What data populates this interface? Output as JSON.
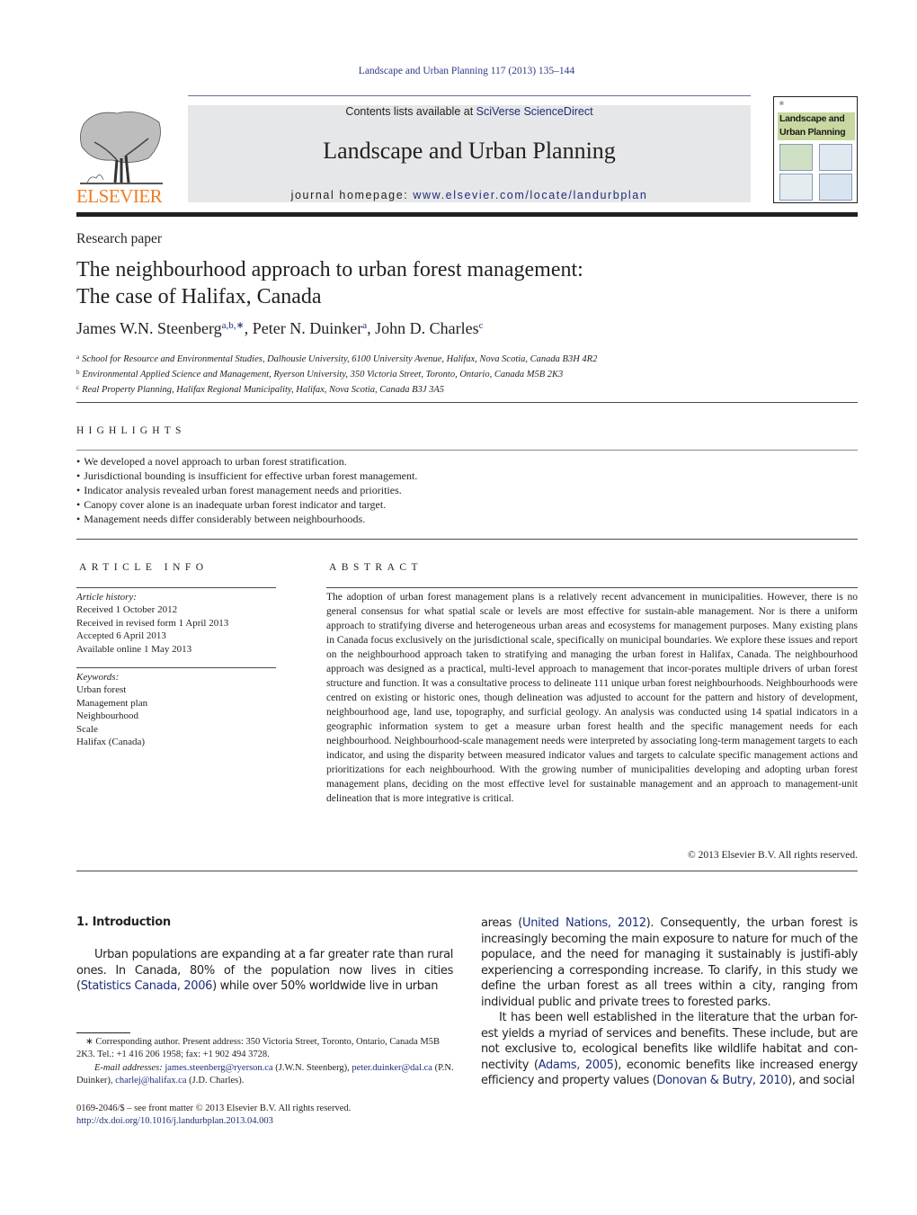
{
  "header": {
    "journal_ref": "Landscape and Urban Planning 117 (2013) 135–144",
    "contents_prefix": "Contents lists available at ",
    "contents_link": "SciVerse ScienceDirect",
    "journal_name": "Landscape and Urban Planning",
    "homepage_prefix": "journal homepage: ",
    "homepage_link": "www.elsevier.com/locate/landurbplan",
    "publisher_logo_text": "ELSEVIER",
    "cover_title_line1": "Landscape and",
    "cover_title_line2": "Urban Planning"
  },
  "article": {
    "type": "Research paper",
    "title_line1": "The neighbourhood approach to urban forest management:",
    "title_line2": "The case of Halifax, Canada",
    "authors": [
      {
        "name": "James W.N. Steenberg",
        "sup": "a,b,∗",
        "sep": ", "
      },
      {
        "name": "Peter N. Duinker",
        "sup": "a",
        "sep": ", "
      },
      {
        "name": "John D. Charles",
        "sup": "c",
        "sep": ""
      }
    ],
    "affiliations": [
      {
        "key": "a",
        "text": "School for Resource and Environmental Studies, Dalhousie University, 6100 University Avenue, Halifax, Nova Scotia, Canada B3H 4R2"
      },
      {
        "key": "b",
        "text": "Environmental Applied Science and Management, Ryerson University, 350 Victoria Street, Toronto, Ontario, Canada M5B 2K3"
      },
      {
        "key": "c",
        "text": "Real Property Planning, Halifax Regional Municipality, Halifax, Nova Scotia, Canada B3J 3A5"
      }
    ]
  },
  "highlights": {
    "heading": "HIGHLIGHTS",
    "items": [
      "We developed a novel approach to urban forest stratification.",
      "Jurisdictional bounding is insufficient for effective urban forest management.",
      "Indicator analysis revealed urban forest management needs and priorities.",
      "Canopy cover alone is an inadequate urban forest indicator and target.",
      "Management needs differ considerably between neighbourhoods."
    ]
  },
  "article_info": {
    "heading": "ARTICLE INFO",
    "history_label": "Article history:",
    "history": [
      "Received 1 October 2012",
      "Received in revised form 1 April 2013",
      "Accepted 6 April 2013",
      "Available online 1 May 2013"
    ],
    "keywords_label": "Keywords:",
    "keywords": [
      "Urban forest",
      "Management plan",
      "Neighbourhood",
      "Scale",
      "Halifax (Canada)"
    ]
  },
  "abstract": {
    "heading": "ABSTRACT",
    "text": "The adoption of urban forest management plans is a relatively recent advancement in municipalities. However, there is no general consensus for what spatial scale or levels are most effective for sustain-able management. Nor is there a uniform approach to stratifying diverse and heterogeneous urban areas and ecosystems for management purposes. Many existing plans in Canada focus exclusively on the jurisdictional scale, specifically on municipal boundaries. We explore these issues and report on the neighbourhood approach taken to stratifying and managing the urban forest in Halifax, Canada. The neighbourhood approach was designed as a practical, multi-level approach to management that incor-porates multiple drivers of urban forest structure and function. It was a consultative process to delineate 111 unique urban forest neighbourhoods. Neighbourhoods were centred on existing or historic ones, though delineation was adjusted to account for the pattern and history of development, neighbourhood age, land use, topography, and surficial geology. An analysis was conducted using 14 spatial indicators in a geographic information system to get a measure urban forest health and the specific management needs for each neighbourhood. Neighbourhood-scale management needs were interpreted by associating long-term management targets to each indicator, and using the disparity between measured indicator values and targets to calculate specific management actions and prioritizations for each neighbourhood. With the growing number of municipalities developing and adopting urban forest management plans, deciding on the most effective level for sustainable management and an approach to management-unit delineation that is more integrative is critical.",
    "copyright": "© 2013 Elsevier B.V. All rights reserved."
  },
  "introduction": {
    "heading": "1.  Introduction",
    "left_p1_a": "Urban populations are expanding at a far greater rate than rural ones. In Canada, 80% of the population now lives in cities (",
    "left_p1_cite": "Statistics Canada, 2006",
    "left_p1_b": ") while over 50% worldwide live in urban",
    "right_p1_a": "areas (",
    "right_p1_cite": "United Nations, 2012",
    "right_p1_b": "). Consequently, the urban forest is increasingly becoming the main exposure to nature for much of the populace, and the need for managing it sustainably is justifi-ably experiencing a corresponding increase. To clarify, in this study we define the urban forest as all trees within a city, ranging from individual public and private trees to forested parks.",
    "right_p2_a": "It has been well established in the literature that the urban for-est yields a myriad of services and benefits. These include, but are not exclusive to, ecological benefits like wildlife habitat and con-nectivity (",
    "right_p2_cite1": "Adams, 2005",
    "right_p2_b": "), economic benefits like increased energy efficiency and property values (",
    "right_p2_cite2": "Donovan & Butry, 2010",
    "right_p2_c": "), and social"
  },
  "footnote": {
    "corresponding": "∗ Corresponding author. Present address: 350 Victoria Street, Toronto, Ontario, Canada M5B 2K3. Tel.: +1 416 206 1958; fax: +1 902 494 3728.",
    "email_label": "E-mail addresses:",
    "emails": [
      {
        "email": "james.steenberg@ryerson.ca",
        "who": " (J.W.N. Steenberg),"
      },
      {
        "email": "peter.duinker@dal.ca",
        "who": " (P.N. Duinker), "
      },
      {
        "email": "charlej@halifax.ca",
        "who": " (J.D. Charles)."
      }
    ],
    "front_matter": "0169-2046/$ – see front matter © 2013 Elsevier B.V. All rights reserved.",
    "doi": "http://dx.doi.org/10.1016/j.landurbplan.2013.04.003"
  },
  "colors": {
    "link": "#1f2e7a",
    "elsevier_orange": "#f07c22",
    "banner_gray": "#e6e7e8"
  }
}
